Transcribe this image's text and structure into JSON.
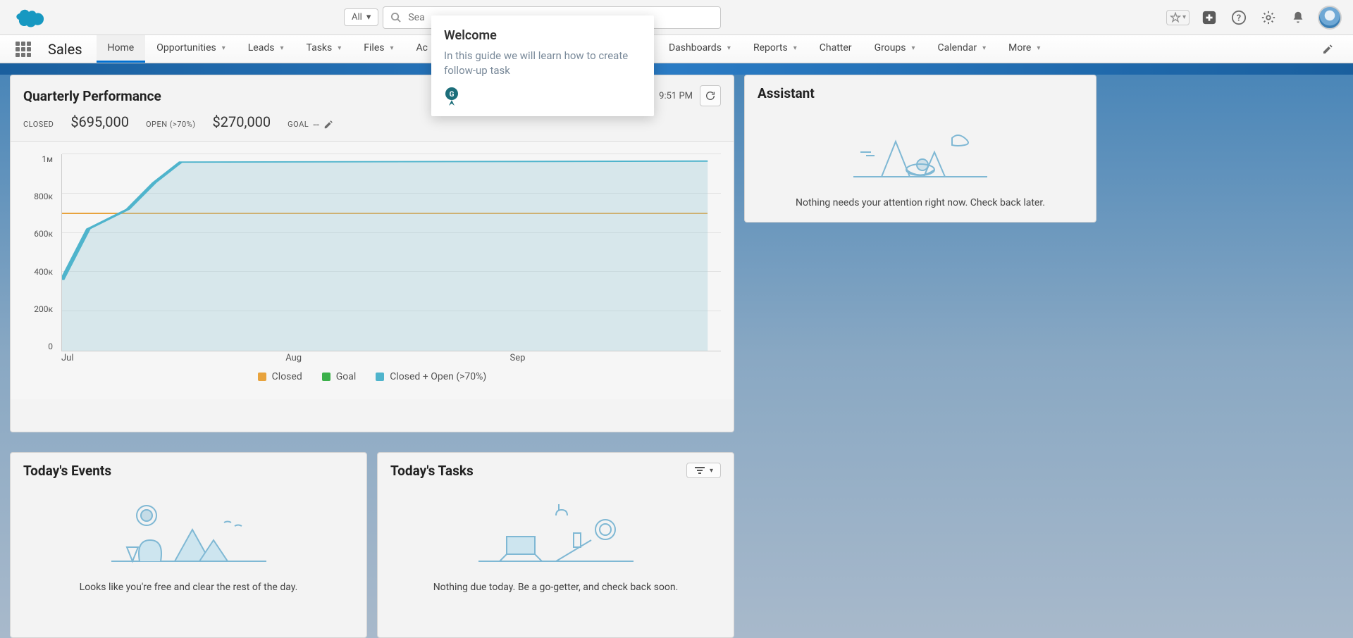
{
  "header": {
    "search_filter": "All",
    "search_placeholder": "Sea"
  },
  "nav": {
    "app_name": "Sales",
    "items": [
      "Home",
      "Opportunities",
      "Leads",
      "Tasks",
      "Files",
      "Ac",
      "Dashboards",
      "Reports",
      "Chatter",
      "Groups",
      "Calendar",
      "More"
    ]
  },
  "welcome": {
    "title": "Welcome",
    "body": "In this guide we will learn how to create follow-up task"
  },
  "qp": {
    "title": "Quarterly Performance",
    "closed_label": "CLOSED",
    "closed_value": "$695,000",
    "open_label": "OPEN (>70%)",
    "open_value": "$270,000",
    "goal_label": "GOAL",
    "goal_value": "--",
    "timestamp": "9:51 PM"
  },
  "chart_data": {
    "type": "line",
    "x": [
      "Jul",
      "Aug",
      "Sep"
    ],
    "ylabel": "",
    "ylim": [
      0,
      1000000
    ],
    "yticks": [
      "0",
      "200к",
      "400к",
      "600к",
      "800к",
      "1м"
    ],
    "series": [
      {
        "name": "Closed",
        "color": "#e8a33d",
        "values": [
          695000,
          695000,
          695000
        ]
      },
      {
        "name": "Goal",
        "color": "#3bb04a",
        "values": []
      },
      {
        "name": "Closed + Open (>70%)",
        "color": "#4fb4cc",
        "values_detailed": [
          {
            "x_frac": 0.0,
            "y": 360000
          },
          {
            "x_frac": 0.04,
            "y": 620000
          },
          {
            "x_frac": 0.1,
            "y": 720000
          },
          {
            "x_frac": 0.14,
            "y": 855000
          },
          {
            "x_frac": 0.18,
            "y": 960000
          },
          {
            "x_frac": 1.0,
            "y": 965000
          }
        ]
      }
    ],
    "legend": [
      "Closed",
      "Goal",
      "Closed + Open (>70%)"
    ]
  },
  "assistant": {
    "title": "Assistant",
    "empty": "Nothing needs your attention right now. Check back later."
  },
  "events": {
    "title": "Today's Events",
    "empty": "Looks like you're free and clear the rest of the day."
  },
  "tasks": {
    "title": "Today's Tasks",
    "empty": "Nothing due today. Be a go-getter, and check back soon."
  }
}
